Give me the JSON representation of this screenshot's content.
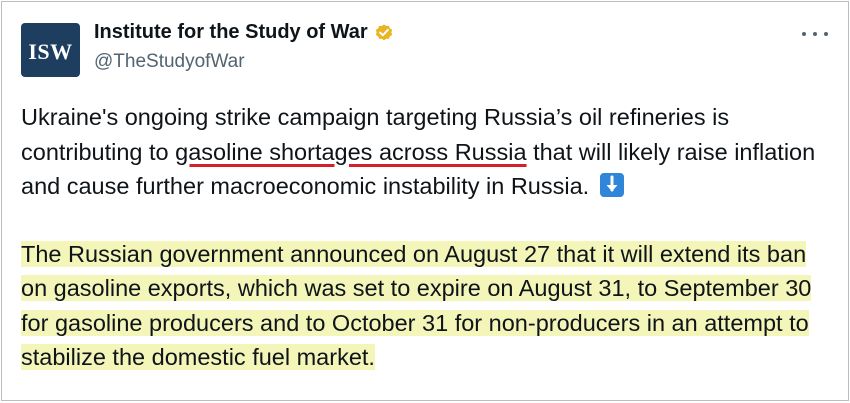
{
  "author": {
    "display_name": "Institute for the Study of War",
    "handle": "@TheStudyofWar",
    "avatar_text": "ISW",
    "verified": true
  },
  "colors": {
    "underline": "#d4202a",
    "highlight": "#f3f5b9",
    "verified_badge": "#e8b524",
    "avatar_bg": "#1d3e5f"
  },
  "icons": [
    "verified-badge-icon",
    "more-options-icon",
    "down-arrow-emoji-icon"
  ],
  "tweet": {
    "para1": {
      "before": "Ukraine's ongoing strike campaign targeting Russia’s oil refineries is contributing to ",
      "underlined": "gasoline shortages across Russia",
      "after": " that will likely raise inflation and cause further macroeconomic instability in Russia."
    },
    "para2": "The Russian government announced on August 27 that it will extend its ban on gasoline exports, which was set to expire on August 31, to September 30 for gasoline producers and to October 31 for non-producers in an attempt to stabilize the domestic fuel market."
  }
}
